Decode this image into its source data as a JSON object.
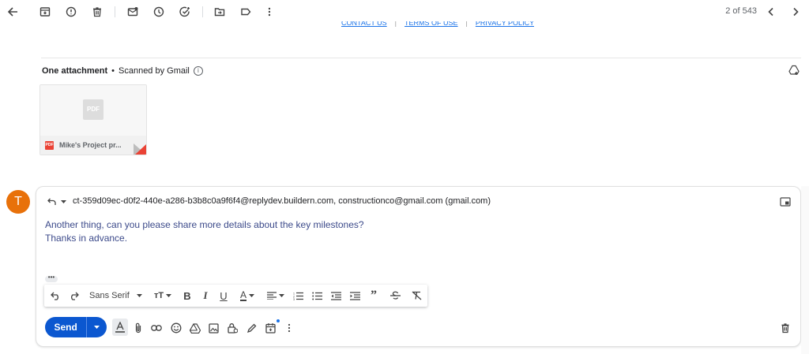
{
  "topbar": {
    "icons": [
      "back-arrow-icon",
      "archive-icon",
      "report-spam-icon",
      "delete-icon",
      "mark-unread-icon",
      "snooze-icon",
      "add-task-icon",
      "move-to-icon",
      "label-icon",
      "more-vert-icon"
    ],
    "pager": "2 of 543"
  },
  "footer_links": [
    "CONTACT US",
    "TERMS OF USE",
    "PRIVACY POLICY"
  ],
  "attachment": {
    "heading": "One attachment",
    "scanned": "Scanned by Gmail",
    "pdf_badge": "PDF",
    "mini_badge": "PDF",
    "filename": "Mike's Project pr..."
  },
  "reply": {
    "avatar_letter": "T",
    "recipients": "ct-359d09ec-d0f2-440e-a286-b3b8c0a9f6f4@replydev.buildern.com, constructionco@gmail.com (gmail.com)",
    "body_line1": "Another thing, can you please share more details about the key milestones?",
    "body_line2": "Thanks in advance.",
    "ellipsis": "•••"
  },
  "formatting": {
    "font": "Sans Serif",
    "icons": [
      "undo-icon",
      "redo-icon",
      "font-size-icon",
      "bold-icon",
      "italic-icon",
      "underline-icon",
      "text-color-icon",
      "align-icon",
      "numbered-list-icon",
      "bulleted-list-icon",
      "indent-less-icon",
      "indent-more-icon",
      "quote-icon",
      "strikethrough-icon",
      "remove-formatting-icon"
    ]
  },
  "compose_bottom": {
    "send_label": "Send",
    "icons": [
      "formatting-options-icon",
      "attach-file-icon",
      "insert-link-icon",
      "emoji-icon",
      "drive-icon",
      "insert-photo-icon",
      "confidential-mode-icon",
      "signature-icon",
      "schedule-event-icon",
      "more-options-icon",
      "discard-draft-icon"
    ]
  },
  "colors": {
    "accent": "#0b57d0",
    "avatar": "#e8710a",
    "body_text": "#3c4a8a"
  }
}
